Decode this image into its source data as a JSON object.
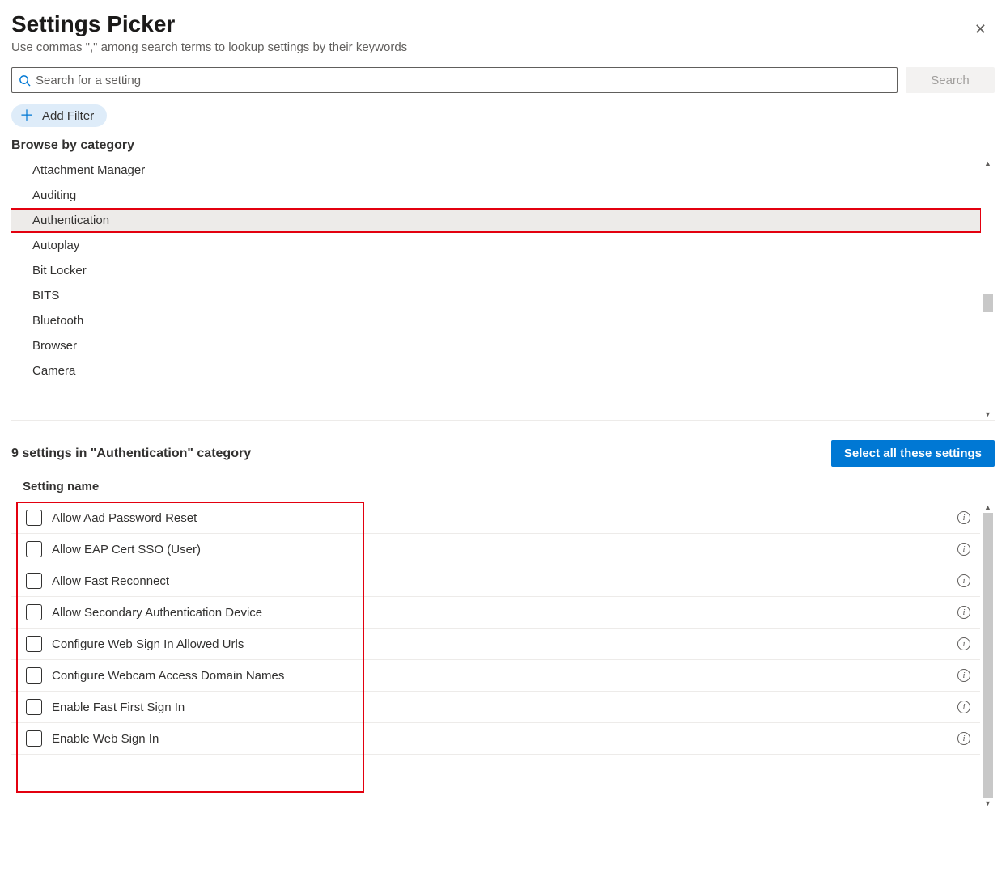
{
  "header": {
    "title": "Settings Picker",
    "subtitle": "Use commas \",\" among search terms to lookup settings by their keywords"
  },
  "search": {
    "placeholder": "Search for a setting",
    "button": "Search"
  },
  "filter": {
    "add_label": "Add Filter"
  },
  "browse": {
    "heading": "Browse by category",
    "categories": [
      "Attachment Manager",
      "Auditing",
      "Authentication",
      "Autoplay",
      "Bit Locker",
      "BITS",
      "Bluetooth",
      "Browser",
      "Camera"
    ],
    "selected_index": 2
  },
  "results": {
    "count_text": "9 settings in \"Authentication\" category",
    "select_all": "Select all these settings",
    "column_header": "Setting name",
    "settings": [
      "Allow Aad Password Reset",
      "Allow EAP Cert SSO (User)",
      "Allow Fast Reconnect",
      "Allow Secondary Authentication Device",
      "Configure Web Sign In Allowed Urls",
      "Configure Webcam Access Domain Names",
      "Enable Fast First Sign In",
      "Enable Web Sign In"
    ]
  }
}
